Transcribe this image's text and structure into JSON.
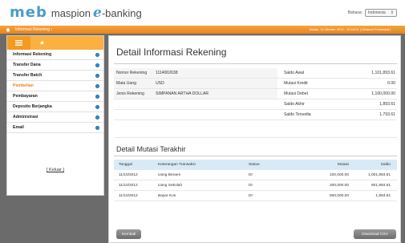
{
  "header": {
    "logo_meb": "meb",
    "logo_name": "maspion",
    "logo_e": "e",
    "logo_banking": "-banking",
    "language_label": "Bahasa:",
    "language_value": "Indonesia"
  },
  "topbar": {
    "breadcrumb": "Informasi Rekening",
    "datetime": "Kamis, 11 Oktober 2012 - 10:18:51 | Selamat Pelakawat |",
    "logout": "Keluar"
  },
  "sidebar": {
    "items": [
      {
        "label": "Informasi Rekening",
        "active": false
      },
      {
        "label": "Transfer Dana",
        "active": false
      },
      {
        "label": "Transfer Batch",
        "active": false
      },
      {
        "label": "Pembelian",
        "active": true
      },
      {
        "label": "Pembayaran",
        "active": false
      },
      {
        "label": "Deposito Berjangka",
        "active": false
      },
      {
        "label": "Administrasi",
        "active": false
      },
      {
        "label": "Email",
        "active": false
      }
    ],
    "logout_label": "[ Keluar ]"
  },
  "main": {
    "title": "Detail Informasi Rekening",
    "info_rows": [
      {
        "label": "Nomor Rekening",
        "value": "1114002638",
        "label2": "Saldo Awal",
        "value2": "1,101,893.61"
      },
      {
        "label": "Mata Uang",
        "value": "USD",
        "label2": "Mutasi Kredit",
        "value2": "0.00"
      },
      {
        "label": "Jenis Rekening",
        "value": "SIMPANAN ARTHA DOLLAR",
        "label2": "Mutasi Debet",
        "value2": "1,100,000.00"
      },
      {
        "label": "",
        "value": "",
        "label2": "Saldo Akhir",
        "value2": "1,893.61"
      },
      {
        "label": "",
        "value": "",
        "label2": "Saldo Tersedia",
        "value2": "1,793.61"
      }
    ],
    "mutasi_title": "Detail Mutasi Terakhir",
    "mutasi_headers": [
      "Tanggal",
      "Keterangan Transaksi",
      "Status",
      "Mutasi",
      "Saldo"
    ],
    "mutasi_rows": [
      [
        "11/10/2012",
        "Uang Beraen",
        "Dr",
        "100,000.00",
        "1,001,893.61"
      ],
      [
        "11/10/2012",
        "Uang Sekolah",
        "Dr",
        "200,000.00",
        "801,893.61"
      ],
      [
        "11/10/2012",
        "Bayar Kos",
        "Dr",
        "800,000.00",
        "1,893.61"
      ]
    ],
    "back_button": "Kembali",
    "download_button": "Download CSV"
  }
}
